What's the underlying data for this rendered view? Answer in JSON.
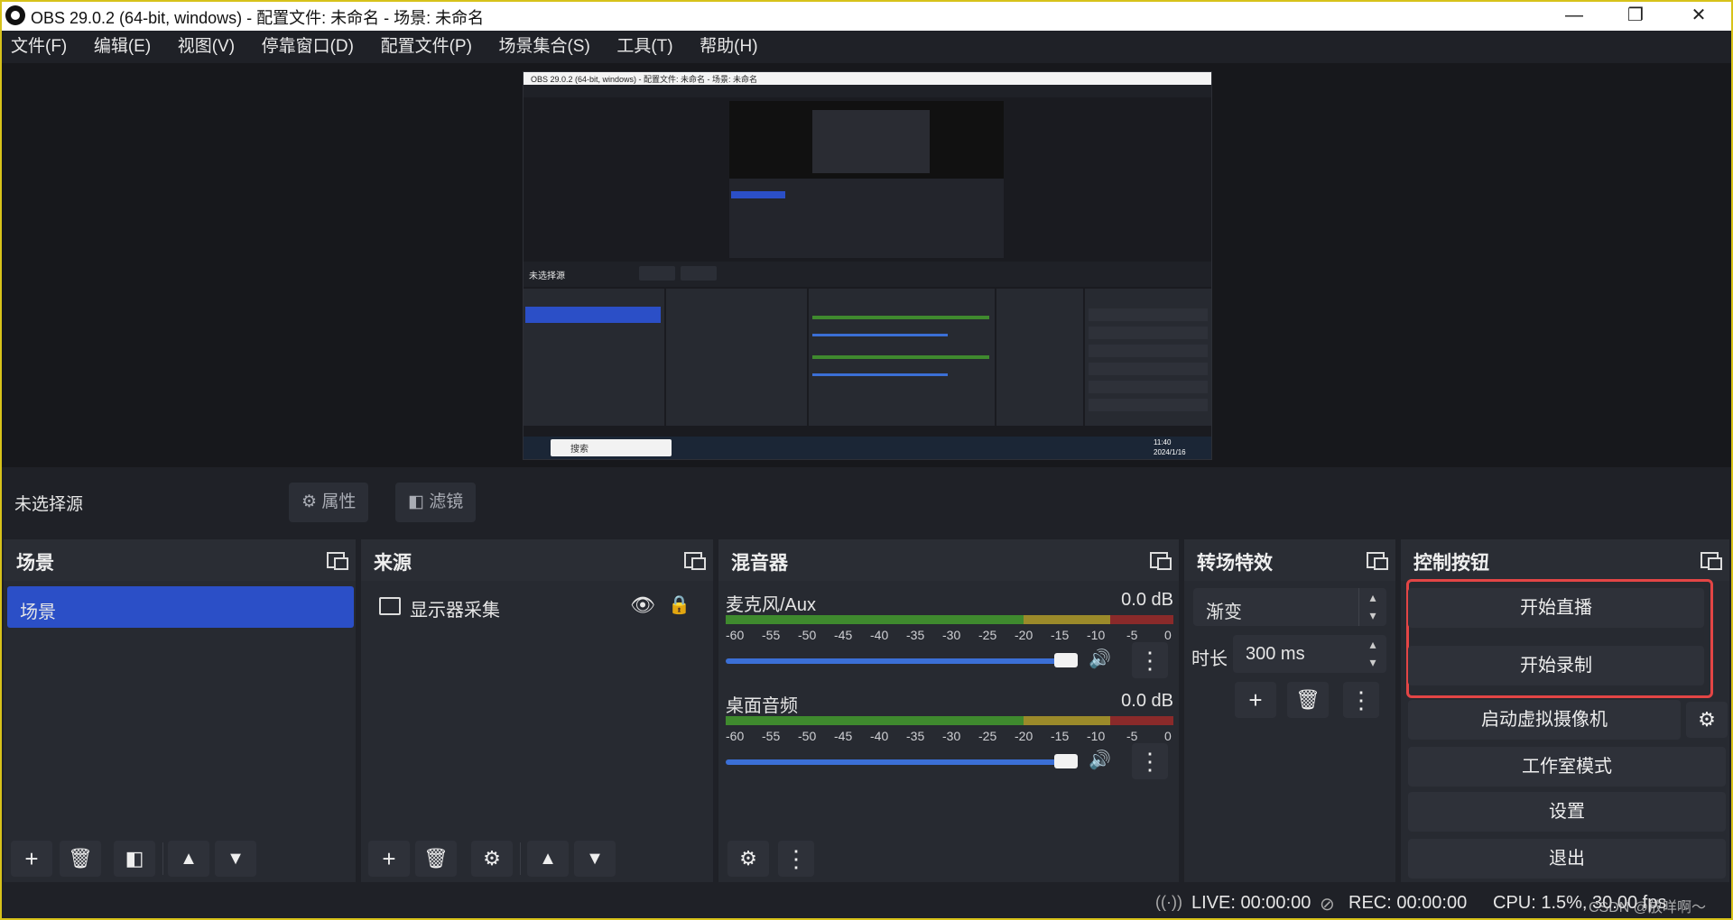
{
  "window": {
    "title": "OBS 29.0.2 (64-bit, windows) - 配置文件: 未命名 - 场景: 未命名",
    "minimize": "—",
    "restore": "❐",
    "close": "✕"
  },
  "menu": [
    "文件(F)",
    "编辑(E)",
    "视图(V)",
    "停靠窗口(D)",
    "配置文件(P)",
    "场景集合(S)",
    "工具(T)",
    "帮助(H)"
  ],
  "source_toolbar": {
    "no_source": "未选择源",
    "properties": "属性",
    "filters": "滤镜"
  },
  "docks": {
    "scenes": {
      "title": "场景",
      "items": [
        "场景"
      ]
    },
    "sources": {
      "title": "来源",
      "items": [
        "显示器采集"
      ]
    },
    "mixer": {
      "title": "混音器",
      "channels": [
        {
          "name": "麦克风/Aux",
          "db": "0.0 dB"
        },
        {
          "name": "桌面音频",
          "db": "0.0 dB"
        }
      ],
      "ticks": [
        "-60",
        "-55",
        "-50",
        "-45",
        "-40",
        "-35",
        "-30",
        "-25",
        "-20",
        "-15",
        "-10",
        "-5",
        "0"
      ]
    },
    "transitions": {
      "title": "转场特效",
      "selected": "渐变",
      "duration_label": "时长",
      "duration_value": "300 ms"
    },
    "controls": {
      "title": "控制按钮",
      "start_streaming": "开始直播",
      "start_recording": "开始录制",
      "start_virtual_cam": "启动虚拟摄像机",
      "studio_mode": "工作室模式",
      "settings": "设置",
      "exit": "退出"
    }
  },
  "status": {
    "live": "LIVE: 00:00:00",
    "rec": "REC: 00:00:00",
    "cpu": "CPU: 1.5%, 30.00 fps",
    "watermark": "CSDN @放咩啊～"
  },
  "preview_inner": {
    "title": "OBS 29.0.2 (64-bit, windows) - 配置文件: 未命名 - 场景: 未命名",
    "no_source": "未选择源",
    "search": "搜索",
    "time": "11:40",
    "date": "2024/1/16"
  },
  "colors": {
    "accent": "#2b4fc7",
    "highlight": "#e34545",
    "meter_green": "#3f8a2e",
    "meter_yellow": "#9b8a2a",
    "meter_red": "#8a2a2a"
  }
}
